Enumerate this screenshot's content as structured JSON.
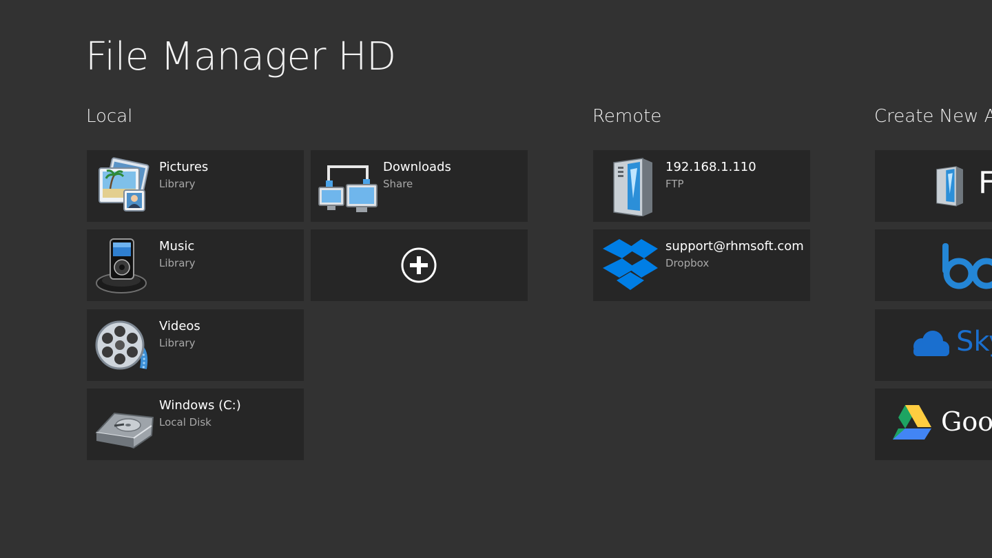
{
  "app": {
    "title": "File Manager HD"
  },
  "sections": {
    "local": "Local",
    "remote": "Remote",
    "create": "Create New Ac"
  },
  "local": {
    "pictures": {
      "name": "Pictures",
      "type": "Library"
    },
    "music": {
      "name": "Music",
      "type": "Library"
    },
    "videos": {
      "name": "Videos",
      "type": "Library"
    },
    "windows": {
      "name": "Windows (C:)",
      "type": "Local Disk"
    },
    "downloads": {
      "name": "Downloads",
      "type": "Share"
    }
  },
  "remote": {
    "ftp": {
      "name": "192.168.1.110",
      "type": "FTP"
    },
    "dropbox": {
      "name": "support@rhmsoft.com",
      "type": "Dropbox"
    }
  },
  "create_new": {
    "ftp": "F",
    "box": "bo",
    "skydrive": "Sky",
    "google": "Goog"
  },
  "colors": {
    "background": "#323232",
    "tile": "#262626",
    "dropbox_blue": "#007ee5",
    "box_blue": "#2486d6",
    "skydrive_blue": "#1a6fcf"
  },
  "icons": {
    "pictures": "pictures-library-icon",
    "music": "ipod-dock-icon",
    "videos": "film-reel-icon",
    "windows": "hard-disk-icon",
    "downloads": "network-share-icon",
    "add": "plus-circle-icon",
    "ftp": "server-tower-icon",
    "dropbox": "dropbox-icon",
    "box": "box-logo-icon",
    "skydrive": "cloud-icon",
    "google": "google-drive-icon"
  }
}
